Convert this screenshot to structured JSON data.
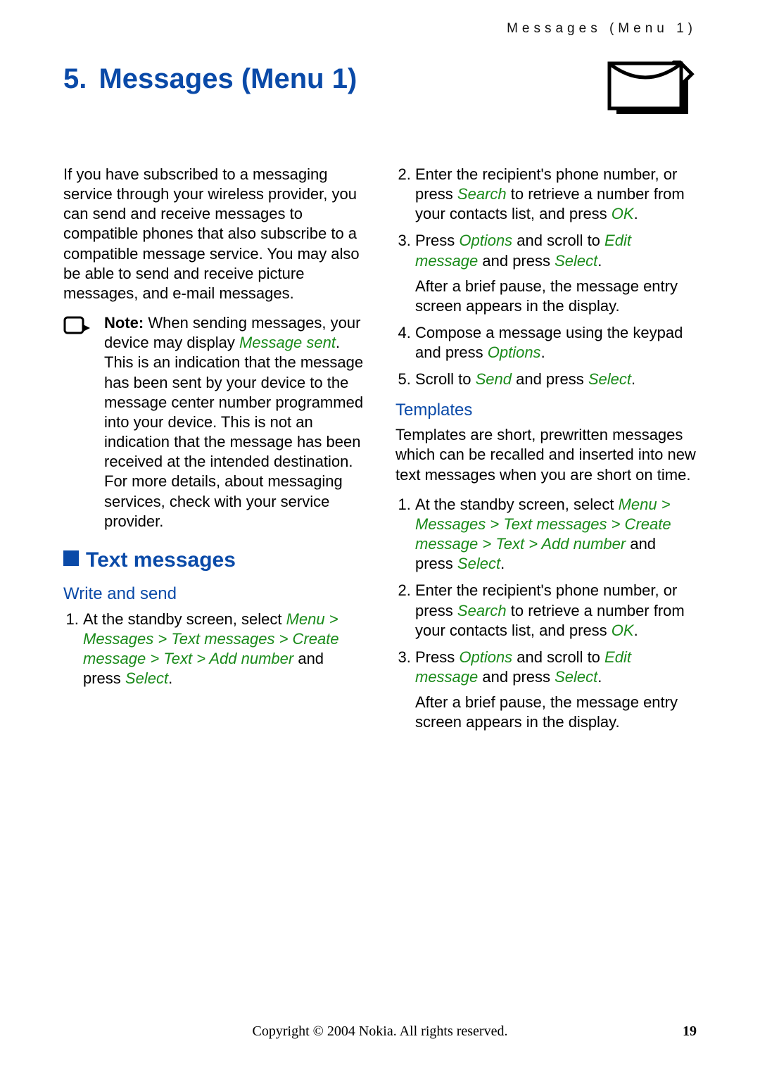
{
  "running_head": "Messages (Menu 1)",
  "chapter": {
    "number": "5.",
    "title": "Messages (Menu 1)"
  },
  "intro": "If you have subscribed to a messaging service through your wireless provider, you can send and receive messages to compatible phones that also subscribe to a compatible message service. You may also be able to send and receive picture messages, and e-mail messages.",
  "note": {
    "label": "Note:",
    "t1": "When sending messages, your device may display ",
    "u1": "Message sent",
    "t2": ". This is an indication that the message has been sent by your device to the message center number programmed into your device. This is not an indication that the message has been received at the intended destination. For more details, about messaging services, check with your service provider."
  },
  "h_text_messages": "Text messages",
  "h_write_send": "Write and send",
  "ws_step1": {
    "t1": "At the standby screen, select ",
    "path": "Menu > Messages > Text messages > Create message > Text > Add number",
    "t2": " and press ",
    "sel": "Select",
    "t3": "."
  },
  "ws_step2": {
    "t1": "Enter the recipient's phone number, or press ",
    "u1": "Search",
    "t2": " to retrieve a number from your contacts list, and press ",
    "u2": "OK",
    "t3": "."
  },
  "ws_step3": {
    "t1": "Press ",
    "u1": "Options",
    "t2": " and scroll to ",
    "u2": "Edit message",
    "t3": " and press ",
    "u3": "Select",
    "t4": ".",
    "after": "After a brief pause, the message entry screen appears in the display."
  },
  "ws_step4": {
    "t1": "Compose a message using the keypad and press ",
    "u1": "Options",
    "t2": "."
  },
  "ws_step5": {
    "t1": "Scroll to ",
    "u1": "Send",
    "t2": " and press ",
    "u2": "Select",
    "t3": "."
  },
  "h_templates": "Templates",
  "templates_intro": "Templates are short, prewritten messages which can be recalled and inserted into new text messages when you are short on time.",
  "tp_step1": {
    "t1": "At the standby screen, select ",
    "path": "Menu > Messages > Text messages > Create message > Text > Add number",
    "t2": " and press ",
    "sel": "Select",
    "t3": "."
  },
  "tp_step2": {
    "t1": "Enter the recipient's phone number, or press ",
    "u1": "Search",
    "t2": " to retrieve a number from your contacts list, and press ",
    "u2": "OK",
    "t3": "."
  },
  "tp_step3": {
    "t1": "Press ",
    "u1": "Options",
    "t2": " and scroll to ",
    "u2": "Edit message",
    "t3": " and press ",
    "u3": "Select",
    "t4": ".",
    "after": "After a brief pause, the message entry screen appears in the display."
  },
  "footer": {
    "copy": "Copyright © 2004 Nokia. All rights reserved.",
    "page": "19"
  }
}
